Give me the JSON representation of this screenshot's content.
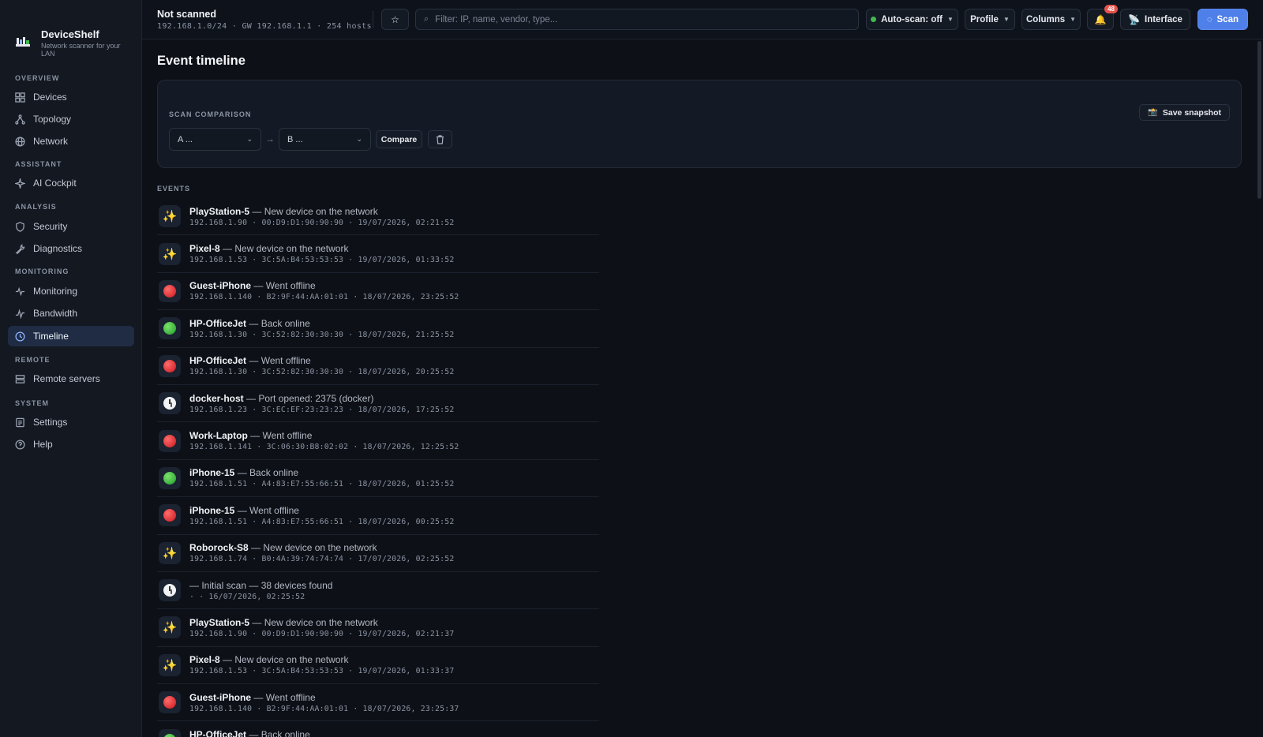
{
  "brand": {
    "name": "DeviceShelf",
    "subtitle": "Network scanner for your LAN"
  },
  "sidebar": {
    "sections": {
      "overview": "OVERVIEW",
      "assistant": "ASSISTANT",
      "analysis": "ANALYSIS",
      "monitoring": "MONITORING",
      "remote": "REMOTE",
      "system": "SYSTEM"
    },
    "items": [
      {
        "label": "Devices",
        "icon": "grid-icon"
      },
      {
        "label": "Topology",
        "icon": "topology-icon"
      },
      {
        "label": "Network",
        "icon": "globe-icon"
      },
      {
        "label": "AI Cockpit",
        "icon": "sparkle-icon"
      },
      {
        "label": "Security",
        "icon": "shield-icon"
      },
      {
        "label": "Diagnostics",
        "icon": "wrench-icon"
      },
      {
        "label": "Monitoring",
        "icon": "pulse-icon"
      },
      {
        "label": "Bandwidth",
        "icon": "bandwidth-icon"
      },
      {
        "label": "Timeline",
        "icon": "clock-icon",
        "active": true
      },
      {
        "label": "Remote servers",
        "icon": "server-icon"
      },
      {
        "label": "Settings",
        "icon": "settings-icon"
      },
      {
        "label": "Help",
        "icon": "help-icon"
      }
    ]
  },
  "topbar": {
    "scan_title": "Not scanned",
    "scan_meta": "192.168.1.0/24 · GW 192.168.1.1 · 254 hosts",
    "search_placeholder": "Filter: IP, name, vendor, type...",
    "autoscan_label": "Auto-scan: off",
    "profile_label": "Profile",
    "columns_label": "Columns",
    "notifications_count": "48",
    "interface_label": "Interface",
    "scan_label": "Scan"
  },
  "main": {
    "title": "Event timeline",
    "comparison": {
      "label": "SCAN COMPARISON",
      "select_a": "A ...",
      "select_b": "B ...",
      "compare_label": "Compare",
      "save_label": "Save snapshot"
    },
    "events_label": "EVENTS",
    "events": [
      {
        "kind": "new",
        "name": "PlayStation-5",
        "desc": "— New device on the network",
        "ip": "192.168.1.90",
        "mac": "00:D9:D1:90:90:90",
        "time": "19/07/2026, 02:21:52"
      },
      {
        "kind": "new",
        "name": "Pixel-8",
        "desc": "— New device on the network",
        "ip": "192.168.1.53",
        "mac": "3C:5A:B4:53:53:53",
        "time": "19/07/2026, 01:33:52"
      },
      {
        "kind": "offline",
        "name": "Guest-iPhone",
        "desc": "— Went offline",
        "ip": "192.168.1.140",
        "mac": "B2:9F:44:AA:01:01",
        "time": "18/07/2026, 23:25:52"
      },
      {
        "kind": "online",
        "name": "HP-OfficeJet",
        "desc": "— Back online",
        "ip": "192.168.1.30",
        "mac": "3C:52:82:30:30:30",
        "time": "18/07/2026, 21:25:52"
      },
      {
        "kind": "offline",
        "name": "HP-OfficeJet",
        "desc": "— Went offline",
        "ip": "192.168.1.30",
        "mac": "3C:52:82:30:30:30",
        "time": "18/07/2026, 20:25:52"
      },
      {
        "kind": "info",
        "name": "docker-host",
        "desc": "— Port opened: 2375 (docker)",
        "ip": "192.168.1.23",
        "mac": "3C:EC:EF:23:23:23",
        "time": "18/07/2026, 17:25:52"
      },
      {
        "kind": "offline",
        "name": "Work-Laptop",
        "desc": "— Went offline",
        "ip": "192.168.1.141",
        "mac": "3C:06:30:B8:02:02",
        "time": "18/07/2026, 12:25:52"
      },
      {
        "kind": "online",
        "name": "iPhone-15",
        "desc": "— Back online",
        "ip": "192.168.1.51",
        "mac": "A4:83:E7:55:66:51",
        "time": "18/07/2026, 01:25:52"
      },
      {
        "kind": "offline",
        "name": "iPhone-15",
        "desc": "— Went offline",
        "ip": "192.168.1.51",
        "mac": "A4:83:E7:55:66:51",
        "time": "18/07/2026, 00:25:52"
      },
      {
        "kind": "new",
        "name": "Roborock-S8",
        "desc": "— New device on the network",
        "ip": "192.168.1.74",
        "mac": "B0:4A:39:74:74:74",
        "time": "17/07/2026, 02:25:52"
      },
      {
        "kind": "info",
        "name": "",
        "desc": "— Initial scan — 38 devices found",
        "ip": "",
        "mac": "",
        "time": "16/07/2026, 02:25:52"
      },
      {
        "kind": "new",
        "name": "PlayStation-5",
        "desc": "— New device on the network",
        "ip": "192.168.1.90",
        "mac": "00:D9:D1:90:90:90",
        "time": "19/07/2026, 02:21:37"
      },
      {
        "kind": "new",
        "name": "Pixel-8",
        "desc": "— New device on the network",
        "ip": "192.168.1.53",
        "mac": "3C:5A:B4:53:53:53",
        "time": "19/07/2026, 01:33:37"
      },
      {
        "kind": "offline",
        "name": "Guest-iPhone",
        "desc": "— Went offline",
        "ip": "192.168.1.140",
        "mac": "B2:9F:44:AA:01:01",
        "time": "18/07/2026, 23:25:37"
      },
      {
        "kind": "online",
        "name": "HP-OfficeJet",
        "desc": "— Back online",
        "ip": "",
        "mac": "",
        "time": ""
      }
    ]
  }
}
